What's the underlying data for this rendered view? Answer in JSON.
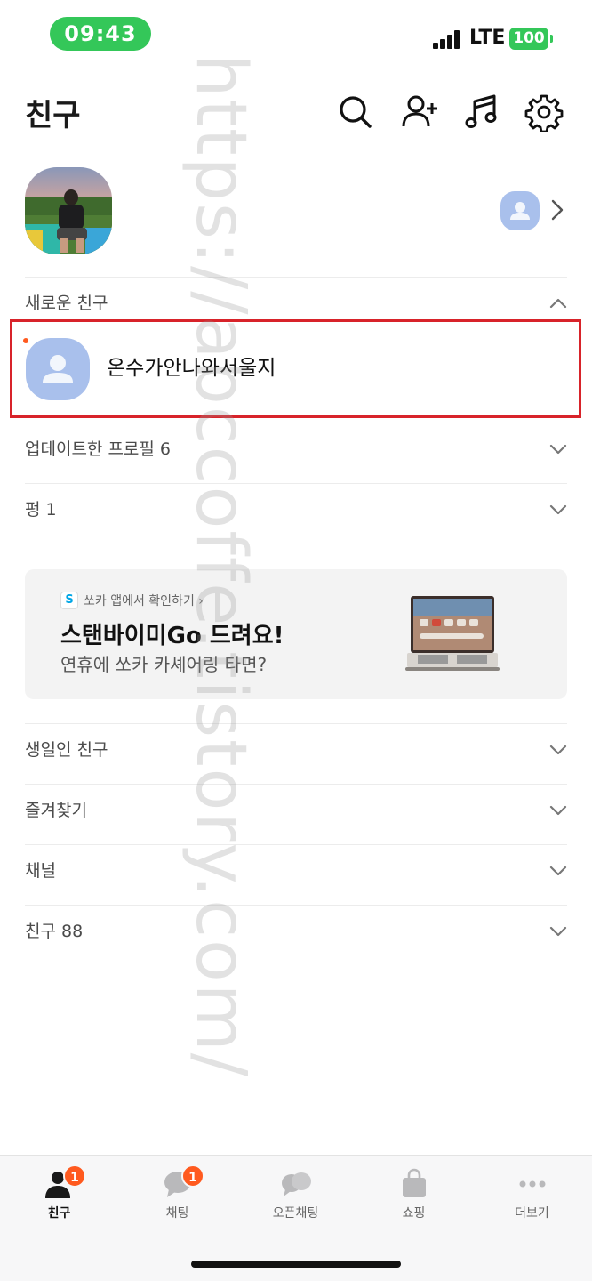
{
  "status_bar": {
    "time": "09:43",
    "network": "LTE",
    "battery": "100"
  },
  "header": {
    "title": "친구",
    "icons": [
      "search-icon",
      "add-friend-icon",
      "music-icon",
      "settings-icon"
    ]
  },
  "sections": {
    "new_friends": "새로운 친구",
    "new_friend_name": "온수가안나와서울지",
    "updated_profiles": "업데이트한 프로필 6",
    "pung": "펑 1",
    "birthday": "생일인 친구",
    "favorites": "즐겨찾기",
    "channels": "채널",
    "friends": "친구 88"
  },
  "ad": {
    "badge": "S",
    "link": "쏘카 앱에서 확인하기 ›",
    "title": "스탠바이미Go 드려요!",
    "subtitle": "연휴에 쏘카 카셰어링 타면?"
  },
  "bottom_nav": {
    "items": [
      {
        "label": "친구",
        "badge": "1",
        "icon": "person-icon"
      },
      {
        "label": "채팅",
        "badge": "1",
        "icon": "chat-icon"
      },
      {
        "label": "오픈채팅",
        "badge": "",
        "icon": "open-chat-icon"
      },
      {
        "label": "쇼핑",
        "badge": "",
        "icon": "shopping-bag-icon"
      },
      {
        "label": "더보기",
        "badge": "",
        "icon": "more-icon"
      }
    ]
  },
  "watermark": "https://abccoffe.tistory.com/",
  "colors": {
    "status_green": "#34c759",
    "badge_orange": "#ff5a1f",
    "highlight_red": "#d8232a",
    "avatar_blue": "#a9c0ec"
  }
}
